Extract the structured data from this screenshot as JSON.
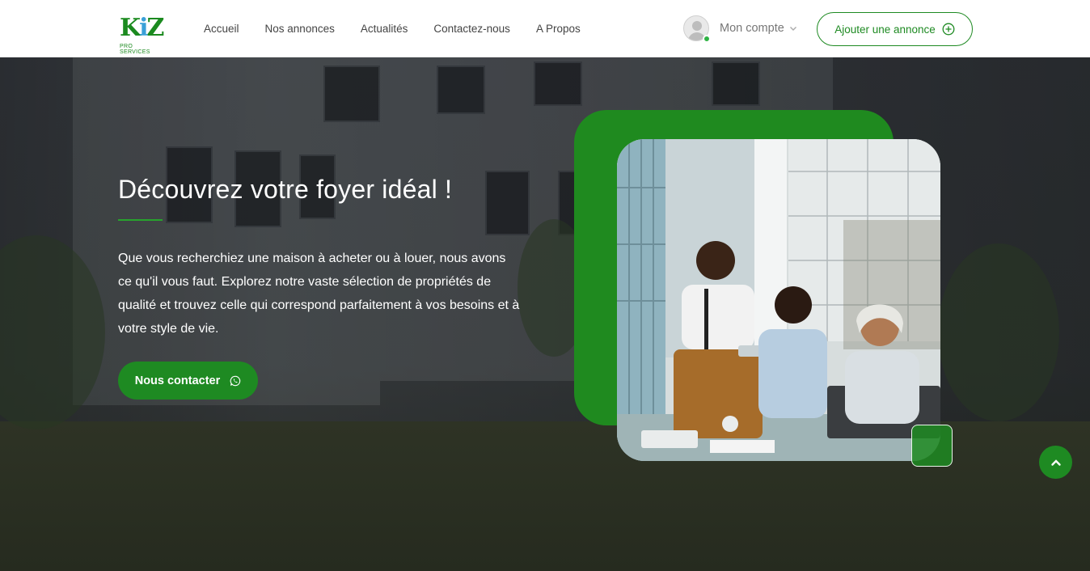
{
  "brand": {
    "logo_mark": "K",
    "logo_dot": "i",
    "logo_mark_end": "Z",
    "logo_tagline": "PRO SERVICES"
  },
  "nav": {
    "items": [
      {
        "label": "Accueil"
      },
      {
        "label": "Nos annonces"
      },
      {
        "label": "Actualités"
      },
      {
        "label": "Contactez-nous"
      },
      {
        "label": "A Propos"
      }
    ]
  },
  "account": {
    "label": "Mon compte",
    "status": "online"
  },
  "header_cta": {
    "label": "Ajouter une annonce"
  },
  "hero": {
    "title": "Découvrez votre foyer idéal !",
    "description": "Que vous recherchiez une maison à acheter ou à louer, nous avons ce qu'il vous faut. Explorez notre vaste sélection de propriétés de qualité et trouvez celle qui correspond parfaitement à vos besoins et à votre style de vie.",
    "cta_label": "Nous contacter",
    "cta_icon": "whatsapp-icon",
    "image_alt": "office-team-photo"
  },
  "colors": {
    "primary": "#1e8a22",
    "accent_blue": "#3aa0d8",
    "text_dark": "#444444"
  }
}
